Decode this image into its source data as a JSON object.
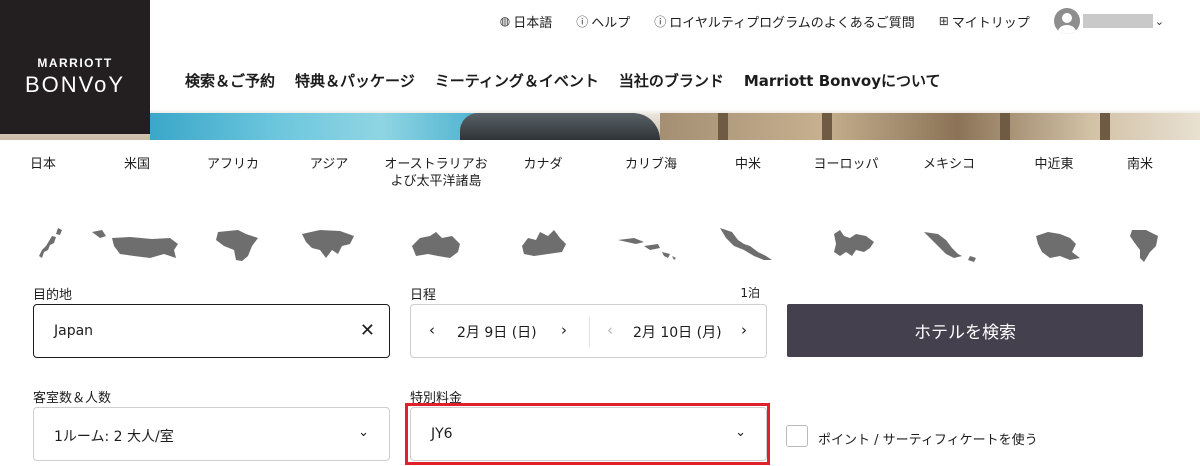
{
  "brand": {
    "logo_top": "MARRIOTT",
    "logo_main": "BONVoY"
  },
  "utility_nav": [
    {
      "icon": "globe-icon",
      "glyph": "🌐",
      "label": "日本語"
    },
    {
      "icon": "help-icon",
      "glyph": "?",
      "label": "ヘルプ"
    },
    {
      "icon": "info-icon",
      "glyph": "i",
      "label": "ロイヤルティプログラムのよくあるご質問"
    },
    {
      "icon": "briefcase-icon",
      "glyph": "⌂",
      "label": "マイトリップ"
    }
  ],
  "main_nav": [
    "検索＆ご予約",
    "特典＆パッケージ",
    "ミーティング＆イベント",
    "当社のブランド",
    "Marriott Bonvoyについて"
  ],
  "regions": [
    {
      "label": "日本",
      "map": "japan"
    },
    {
      "label": "米国",
      "map": "usa"
    },
    {
      "label": "アフリカ",
      "map": "africa"
    },
    {
      "label": "アジア",
      "map": "asia"
    },
    {
      "label": "オーストラリアおよび太平洋諸島",
      "map": "australia"
    },
    {
      "label": "カナダ",
      "map": "canada"
    },
    {
      "label": "カリブ海",
      "map": "caribbean"
    },
    {
      "label": "中米",
      "map": "central-america"
    },
    {
      "label": "ヨーロッパ",
      "map": "europe"
    },
    {
      "label": "メキシコ",
      "map": "mexico"
    },
    {
      "label": "中近東",
      "map": "middle-east"
    },
    {
      "label": "南米",
      "map": "south-america"
    }
  ],
  "search": {
    "destination_label": "目的地",
    "destination_value": "Japan",
    "dates_label": "日程",
    "nights": "1泊",
    "checkin": "2月 9日 (日)",
    "checkout": "2月 10日 (月)",
    "search_button": "ホテルを検索",
    "rooms_label": "客室数＆人数",
    "rooms_value": "1ルーム: 2 大人/室",
    "special_rate_label": "特別料金",
    "special_rate_value": "JY6",
    "points_label": "ポイント / サーティフィケートを使う"
  },
  "colors": {
    "logo_bg": "#231f20",
    "button_bg": "#45404d",
    "highlight": "#e0202a",
    "map_gray": "#6e6e6e"
  }
}
